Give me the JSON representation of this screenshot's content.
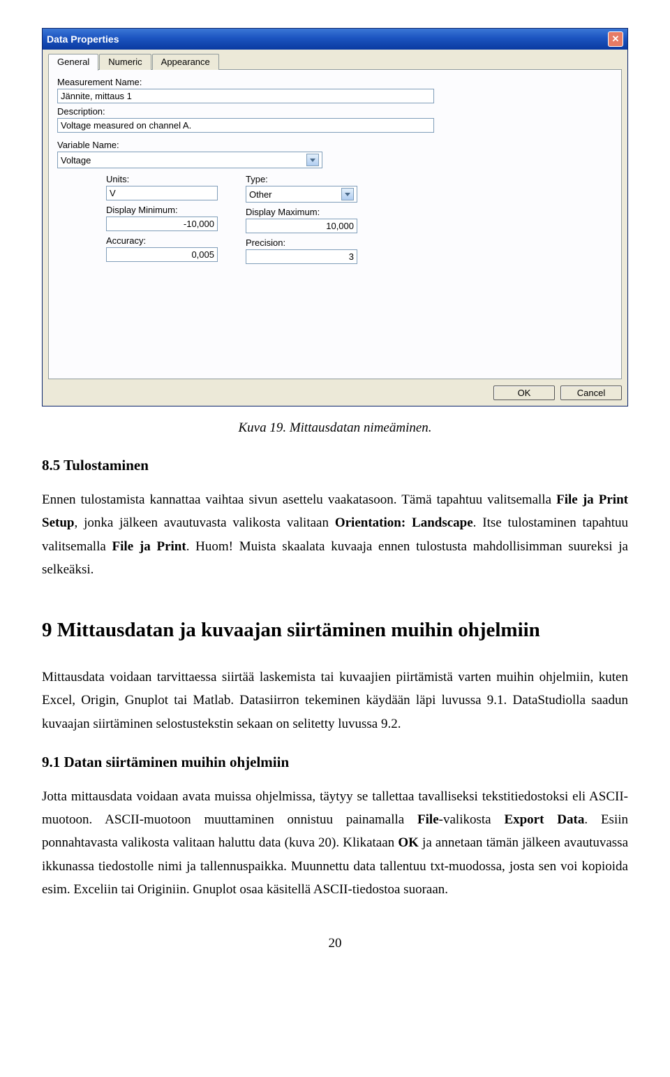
{
  "dialog": {
    "title": "Data Properties",
    "tabs": {
      "general": "General",
      "numeric": "Numeric",
      "appearance": "Appearance"
    },
    "labels": {
      "measurement_name": "Measurement Name:",
      "description": "Description:",
      "variable_name": "Variable Name:",
      "units": "Units:",
      "type": "Type:",
      "display_min": "Display Minimum:",
      "display_max": "Display Maximum:",
      "accuracy": "Accuracy:",
      "precision": "Precision:"
    },
    "values": {
      "measurement_name": "Jännite, mittaus 1",
      "description": "Voltage measured on channel A.",
      "variable_name": "Voltage",
      "units": "V",
      "type": "Other",
      "display_min": "-10,000",
      "display_max": "10,000",
      "accuracy": "0,005",
      "precision": "3"
    },
    "buttons": {
      "ok": "OK",
      "cancel": "Cancel"
    }
  },
  "caption": "Kuva 19. Mittausdatan nimeäminen.",
  "sec85_heading": "8.5   Tulostaminen",
  "para1_a": "Ennen tulostamista kannattaa vaihtaa sivun asettelu vaakatasoon. Tämä tapahtuu valitsemalla ",
  "para1_file_print": "File ja Print Setup",
  "para1_b": ", jonka jälkeen avautuvasta valikosta valitaan ",
  "para1_orientation": "Orientation: Landscape",
  "para1_c": ". Itse tulostaminen tapahtuu valitsemalla ",
  "para1_file_print2": "File ja Print",
  "para1_d": ". Huom! Muista skaalata kuvaaja ennen tulostusta mahdollisimman suureksi ja selkeäksi.",
  "sec9_heading": "9  Mittausdatan ja kuvaajan siirtäminen muihin ohjelmiin",
  "para2": "Mittausdata voidaan tarvittaessa siirtää laskemista tai kuvaajien piirtämistä varten muihin ohjelmiin, kuten Excel, Origin, Gnuplot tai Matlab. Datasiirron tekeminen käydään läpi luvussa 9.1. DataStudiolla saadun kuvaajan siirtäminen selostustekstin sekaan on selitetty luvussa 9.2.",
  "sec91_heading": "9.1   Datan siirtäminen muihin ohjelmiin",
  "para3_a": "Jotta mittausdata voidaan avata muissa ohjelmissa, täytyy se tallettaa tavalliseksi tekstitiedostoksi eli ASCII-muotoon. ASCII-muotoon muuttaminen onnistuu painamalla ",
  "para3_file": "File",
  "para3_b": "-valikosta ",
  "para3_export": "Export Data",
  "para3_c": ". Esiin ponnahtavasta valikosta valitaan haluttu data (kuva 20). Klikataan ",
  "para3_ok": "OK",
  "para3_d": " ja annetaan tämän jälkeen avautuvassa ikkunassa tiedostolle nimi ja tallennuspaikka. Muunnettu data tallentuu txt-muodossa, josta sen voi kopioida esim. Exceliin tai Originiin. Gnuplot osaa käsitellä ASCII-tiedostoa suoraan.",
  "pagenum": "20"
}
